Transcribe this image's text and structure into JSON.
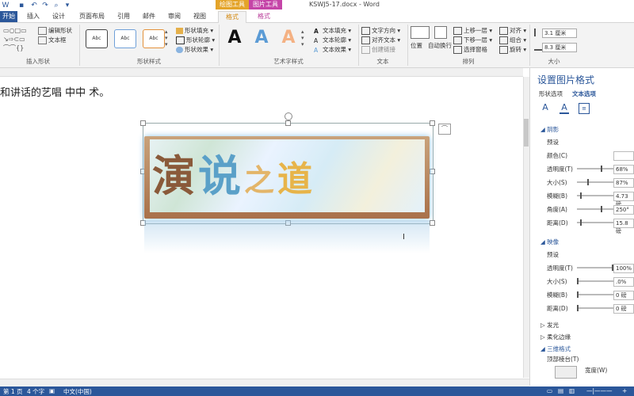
{
  "title_bar": {
    "doc_title": "KSWJ5-17.docx - Word",
    "context_drawing_tools": "绘图工具",
    "context_picture_tools": "图片工具"
  },
  "tabs": [
    {
      "label": "开始"
    },
    {
      "label": "插入"
    },
    {
      "label": "设计"
    },
    {
      "label": "页面布局"
    },
    {
      "label": "引用"
    },
    {
      "label": "邮件"
    },
    {
      "label": "审阅"
    },
    {
      "label": "视图"
    },
    {
      "label": "格式"
    },
    {
      "label": "格式"
    }
  ],
  "ribbon": {
    "insert_shapes": {
      "edit_shape": "编辑形状",
      "text_box": "文本框",
      "label": "插入形状"
    },
    "shape_styles": {
      "swatch_text": "Abc",
      "fill": "形状填充",
      "outline": "形状轮廓",
      "effects": "形状效果",
      "label": "形状样式"
    },
    "wordart": {
      "letter": "A",
      "text_fill": "文本填充",
      "text_outline": "文本轮廓",
      "text_effects": "文本效果",
      "label": "艺术字样式"
    },
    "text": {
      "direction": "文字方向",
      "align": "对齐文本",
      "link": "创建链接",
      "label": "文本"
    },
    "arrange": {
      "position": "位置",
      "wrap": "自动换行",
      "bring_forward": "上移一层",
      "send_backward": "下移一层",
      "selection_pane": "选择窗格",
      "align": "对齐",
      "group": "组合",
      "rotate": "旋转",
      "label": "排列"
    },
    "size": {
      "height": "3.1 厘米",
      "width": "8.3 厘米",
      "label": "大小"
    }
  },
  "document": {
    "line": "和讲话的艺唱  中中  术。",
    "pic_text": [
      "演",
      "说",
      "之",
      "道"
    ]
  },
  "pane": {
    "title": "设置图片格式",
    "tab_shape": "形状选项",
    "tab_text": "文本选项",
    "shadow": {
      "header": "阴影",
      "rows": [
        {
          "label": "预设"
        },
        {
          "label": "颜色(C)"
        },
        {
          "label": "透明度(T)",
          "value": "68%",
          "level": 0.68
        },
        {
          "label": "大小(S)",
          "value": "87%",
          "level": 0.3
        },
        {
          "label": "模糊(B)",
          "value": "4.73 磅",
          "level": 0.1
        },
        {
          "label": "角度(A)",
          "value": "250°",
          "level": 0.69
        },
        {
          "label": "距离(D)",
          "value": "15.8 磅",
          "level": 0.08
        }
      ]
    },
    "reflection": {
      "header": "映像",
      "rows": [
        {
          "label": "预设"
        },
        {
          "label": "透明度(T)",
          "value": "100%",
          "level": 1.0
        },
        {
          "label": "大小(S)",
          "value": ".0%",
          "level": 0.0
        },
        {
          "label": "模糊(B)",
          "value": "0 磅",
          "level": 0.0
        },
        {
          "label": "距离(D)",
          "value": "0 磅",
          "level": 0.0
        }
      ]
    },
    "glow": "发光",
    "soft_edges": "柔化边缘",
    "three_d_format": "三维格式",
    "top_bevel": "顶部棱台(T)",
    "width_label": "宽度(W)"
  },
  "status": {
    "page": "第 1 页",
    "words": "4 个字",
    "lang": "中文(中国)"
  },
  "colors": {
    "accent": "#2b579a",
    "drawing_ctx": "#e4a42a",
    "picture_ctx": "#c545a8"
  }
}
